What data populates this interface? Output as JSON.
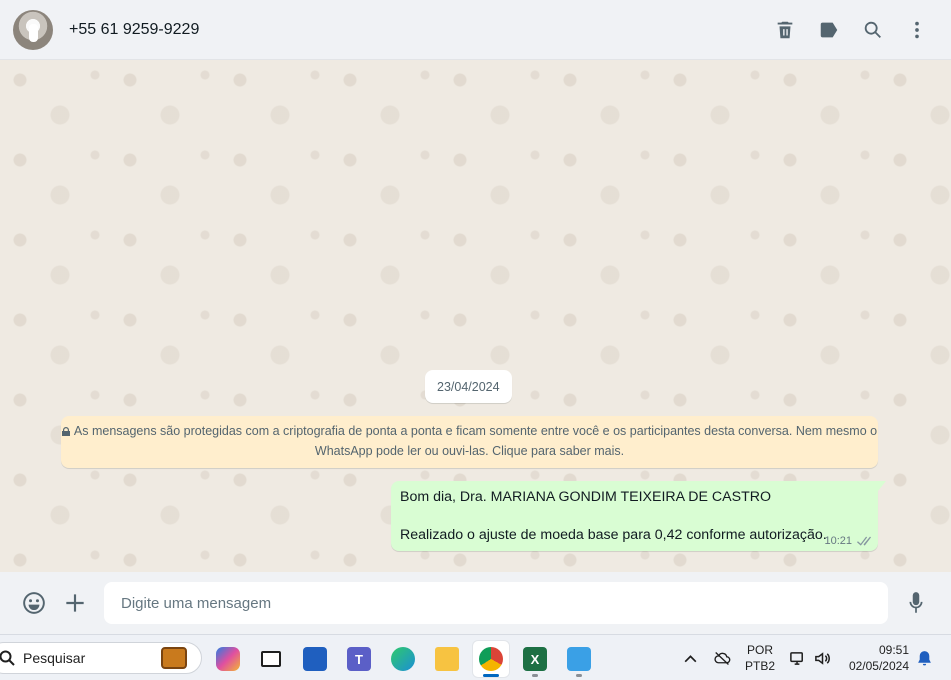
{
  "header": {
    "contact_name": "+55 61 9259-9229",
    "actions": [
      {
        "name": "delete-chat",
        "icon": "trash-icon"
      },
      {
        "name": "labels",
        "icon": "label-tag-icon"
      },
      {
        "name": "search",
        "icon": "search-icon"
      },
      {
        "name": "menu",
        "icon": "more-vertical-icon"
      }
    ]
  },
  "chat": {
    "date_chip": "23/04/2024",
    "encryption_notice": "As mensagens são protegidas com a criptografia de ponta a ponta e ficam somente entre você e os participantes desta conversa. Nem mesmo o WhatsApp pode ler ou ouvi-las. Clique para saber mais.",
    "messages": [
      {
        "direction": "outgoing",
        "line1": "Bom dia, Dra. MARIANA GONDIM TEIXEIRA DE CASTRO",
        "line2": "Realizado o ajuste de moeda base para 0,42 conforme autorização.",
        "time": "10:21",
        "status": "delivered-double-tick"
      }
    ]
  },
  "composer": {
    "placeholder": "Digite uma mensagem"
  },
  "taskbar": {
    "search_label": "Pesquisar",
    "apps": [
      {
        "name": "copilot",
        "icon": "copilot-icon"
      },
      {
        "name": "task-view",
        "icon": "task-view-icon"
      },
      {
        "name": "store",
        "icon": "store-icon"
      },
      {
        "name": "teams",
        "icon": "teams-icon"
      },
      {
        "name": "edge",
        "icon": "edge-icon"
      },
      {
        "name": "file-explorer",
        "icon": "folder-icon"
      },
      {
        "name": "chrome",
        "icon": "chrome-icon",
        "active": true
      },
      {
        "name": "excel",
        "icon": "excel-icon"
      },
      {
        "name": "notepad",
        "icon": "notepad-icon"
      }
    ],
    "lang_line1": "POR",
    "lang_line2": "PTB2",
    "time": "09:51",
    "date": "02/05/2024"
  },
  "colors": {
    "header_bg": "#f0f2f5",
    "chat_bg": "#efeae2",
    "outgoing_bubble": "#d9fdd3",
    "notice_bg": "#ffeecd",
    "icon_gray": "#54656f"
  }
}
